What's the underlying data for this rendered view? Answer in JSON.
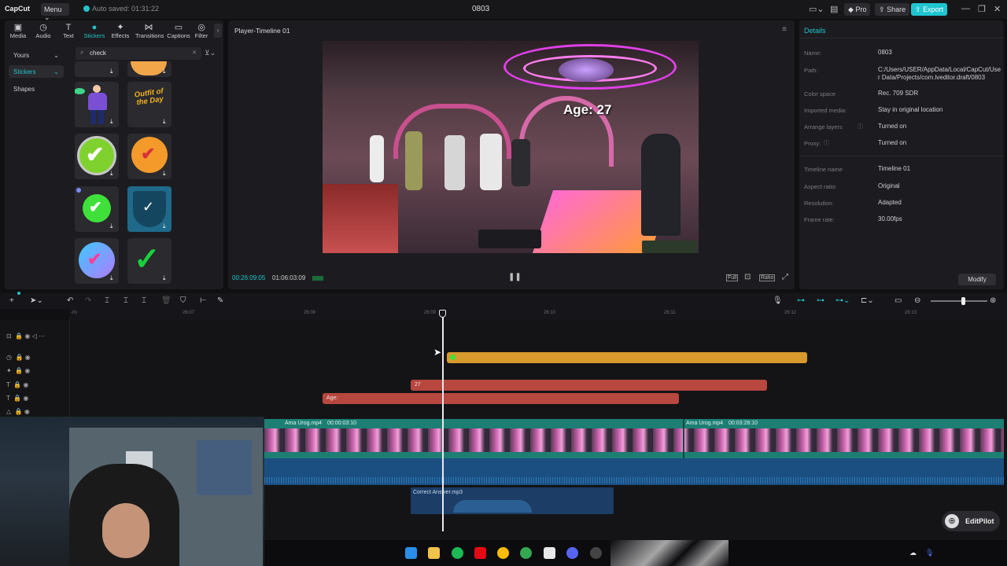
{
  "app": {
    "logo_text": "CapCut",
    "menu_label": "Menu",
    "autosave": "Auto saved: 01:31:22",
    "project_title": "0803",
    "pro_label": "Pro",
    "share_label": "Share",
    "export_label": "Export"
  },
  "left_panel": {
    "tabs": [
      {
        "label": "Media",
        "icon": "media-icon"
      },
      {
        "label": "Audio",
        "icon": "audio-icon"
      },
      {
        "label": "Text",
        "icon": "text-icon"
      },
      {
        "label": "Stickers",
        "icon": "stickers-icon"
      },
      {
        "label": "Effects",
        "icon": "effects-icon"
      },
      {
        "label": "Transitions",
        "icon": "transitions-icon"
      },
      {
        "label": "Captions",
        "icon": "captions-icon"
      },
      {
        "label": "Filter",
        "icon": "filter-icon"
      }
    ],
    "active_tab": "Stickers",
    "categories": [
      "Yours",
      "Stickers",
      "Shapes"
    ],
    "selected_category": "Stickers",
    "search_value": "check",
    "sticker_outfit_text": "Outfit of the Day"
  },
  "player": {
    "title": "Player-Timeline 01",
    "overlay_text": "Age: 27",
    "current_time": "00:26:09:05",
    "total_time": "01:06:03:09",
    "full_label": "Full",
    "ratio_label": "Ratio"
  },
  "details": {
    "title": "Details",
    "rows": [
      {
        "label": "Name:",
        "value": "0803"
      },
      {
        "label": "Path:",
        "value": "C:/Users/USER/AppData/Local/CapCut/User Data/Projects/com.lveditor.draft/0803"
      },
      {
        "label": "Color space",
        "value": "Rec. 709 SDR"
      },
      {
        "label": "Imported media:",
        "value": "Stay in original location"
      },
      {
        "label": "Arrange layers",
        "value": "Turned on"
      },
      {
        "label": "Proxy:",
        "value": "Turned on"
      },
      {
        "label": "Timeline name",
        "value": "Timeline 01"
      },
      {
        "label": "Aspect ratio:",
        "value": "Original"
      },
      {
        "label": "Resolution:",
        "value": "Adapted"
      },
      {
        "label": "Frame rate:",
        "value": "30.00fps"
      }
    ],
    "modify_label": "Modify"
  },
  "timeline": {
    "ruler_ticks": [
      "-0s",
      "26:07",
      "26:08",
      "26:09",
      "26:10",
      "26:11",
      "26:12",
      "26:13"
    ],
    "clip_27": "27",
    "clip_age": "Age:",
    "video_clip_name_1": "Ama Urog.mp4",
    "video_clip_time_1": "00:00:03:10",
    "video_clip_name_2": "Ama Urog.mp4",
    "video_clip_time_2": "00:03:28:10",
    "audio_clip_name": "Correct Answer.mp3"
  },
  "editpilot_label": "EditPilot",
  "colors": {
    "accent": "#22c3c9",
    "sticker_clip": "#d89a2c",
    "text_clip": "#b7473f",
    "video_track": "#1d7f74",
    "audio_track": "#1b4f82"
  }
}
